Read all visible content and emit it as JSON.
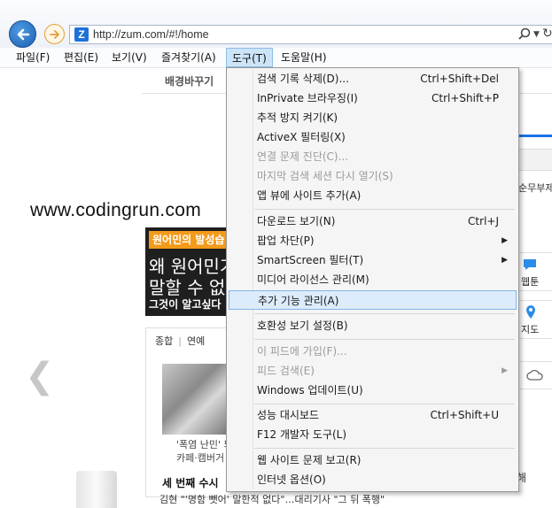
{
  "browser": {
    "url": "http://zum.com/#!/home",
    "site_icon_letter": "Z"
  },
  "menubar": {
    "items": [
      {
        "id": "file",
        "label": "파일(F)"
      },
      {
        "id": "edit",
        "label": "편집(E)"
      },
      {
        "id": "view",
        "label": "보기(V)"
      },
      {
        "id": "favorites",
        "label": "즐겨찾기(A)"
      },
      {
        "id": "tools",
        "label": "도구(T)"
      },
      {
        "id": "help",
        "label": "도움말(H)"
      }
    ]
  },
  "tools_menu": {
    "items": [
      {
        "label": "검색 기록 삭제(D)...",
        "shortcut": "Ctrl+Shift+Del",
        "enabled": true
      },
      {
        "label": "InPrivate 브라우징(I)",
        "shortcut": "Ctrl+Shift+P",
        "enabled": true
      },
      {
        "label": "추적 방지 켜기(K)",
        "shortcut": "",
        "enabled": true
      },
      {
        "label": "ActiveX 필터링(X)",
        "shortcut": "",
        "enabled": true
      },
      {
        "label": "연결 문제 진단(C)...",
        "shortcut": "",
        "enabled": false
      },
      {
        "label": "마지막 검색 세션 다시 열기(S)",
        "shortcut": "",
        "enabled": false
      },
      {
        "label": "앱 뷰에 사이트 추가(A)",
        "shortcut": "",
        "enabled": true
      },
      {
        "label": "다운로드 보기(N)",
        "shortcut": "Ctrl+J",
        "enabled": true
      },
      {
        "label": "팝업 차단(P)",
        "shortcut": "",
        "enabled": true,
        "submenu": true
      },
      {
        "label": "SmartScreen 필터(T)",
        "shortcut": "",
        "enabled": true,
        "submenu": true
      },
      {
        "label": "미디어 라이선스 관리(M)",
        "shortcut": "",
        "enabled": true
      },
      {
        "label": "추가 기능 관리(A)",
        "shortcut": "",
        "enabled": true,
        "highlighted": true
      },
      {
        "label": "호환성 보기 설정(B)",
        "shortcut": "",
        "enabled": true
      },
      {
        "label": "이 피드에 가입(F)...",
        "shortcut": "",
        "enabled": false
      },
      {
        "label": "피드 검색(E)",
        "shortcut": "",
        "enabled": false,
        "submenu": true
      },
      {
        "label": "Windows 업데이트(U)",
        "shortcut": "",
        "enabled": true
      },
      {
        "label": "성능 대시보드",
        "shortcut": "Ctrl+Shift+U",
        "enabled": true
      },
      {
        "label": "F12 개발자 도구(L)",
        "shortcut": "",
        "enabled": true
      },
      {
        "label": "웹 사이트 문제 보고(R)",
        "shortcut": "",
        "enabled": true
      },
      {
        "label": "인터넷 옵션(O)",
        "shortcut": "",
        "enabled": true
      }
    ]
  },
  "page": {
    "subnav_label": "배경바꾸기",
    "watermark": "www.codingrun.com",
    "banner": {
      "tag": "원어민의 발성습",
      "line1": "왜 원어민가",
      "line2": "말할 수 없",
      "line3": "그것이 알고싶다"
    },
    "news_tabs": [
      "종합",
      "연예"
    ],
    "photo_caption1": "'폭염 난민' 되",
    "photo_caption2": "카페·캠버거",
    "headline": "세 번째 수시",
    "subhead": "김현 \"'명함 뺏어' 말한적 없다\"…대리기사 \"그 뒤 폭행\"",
    "right_text": "순무부제",
    "webtoon_label": "웹툰",
    "map_label": "지도",
    "right_hae": "해"
  }
}
